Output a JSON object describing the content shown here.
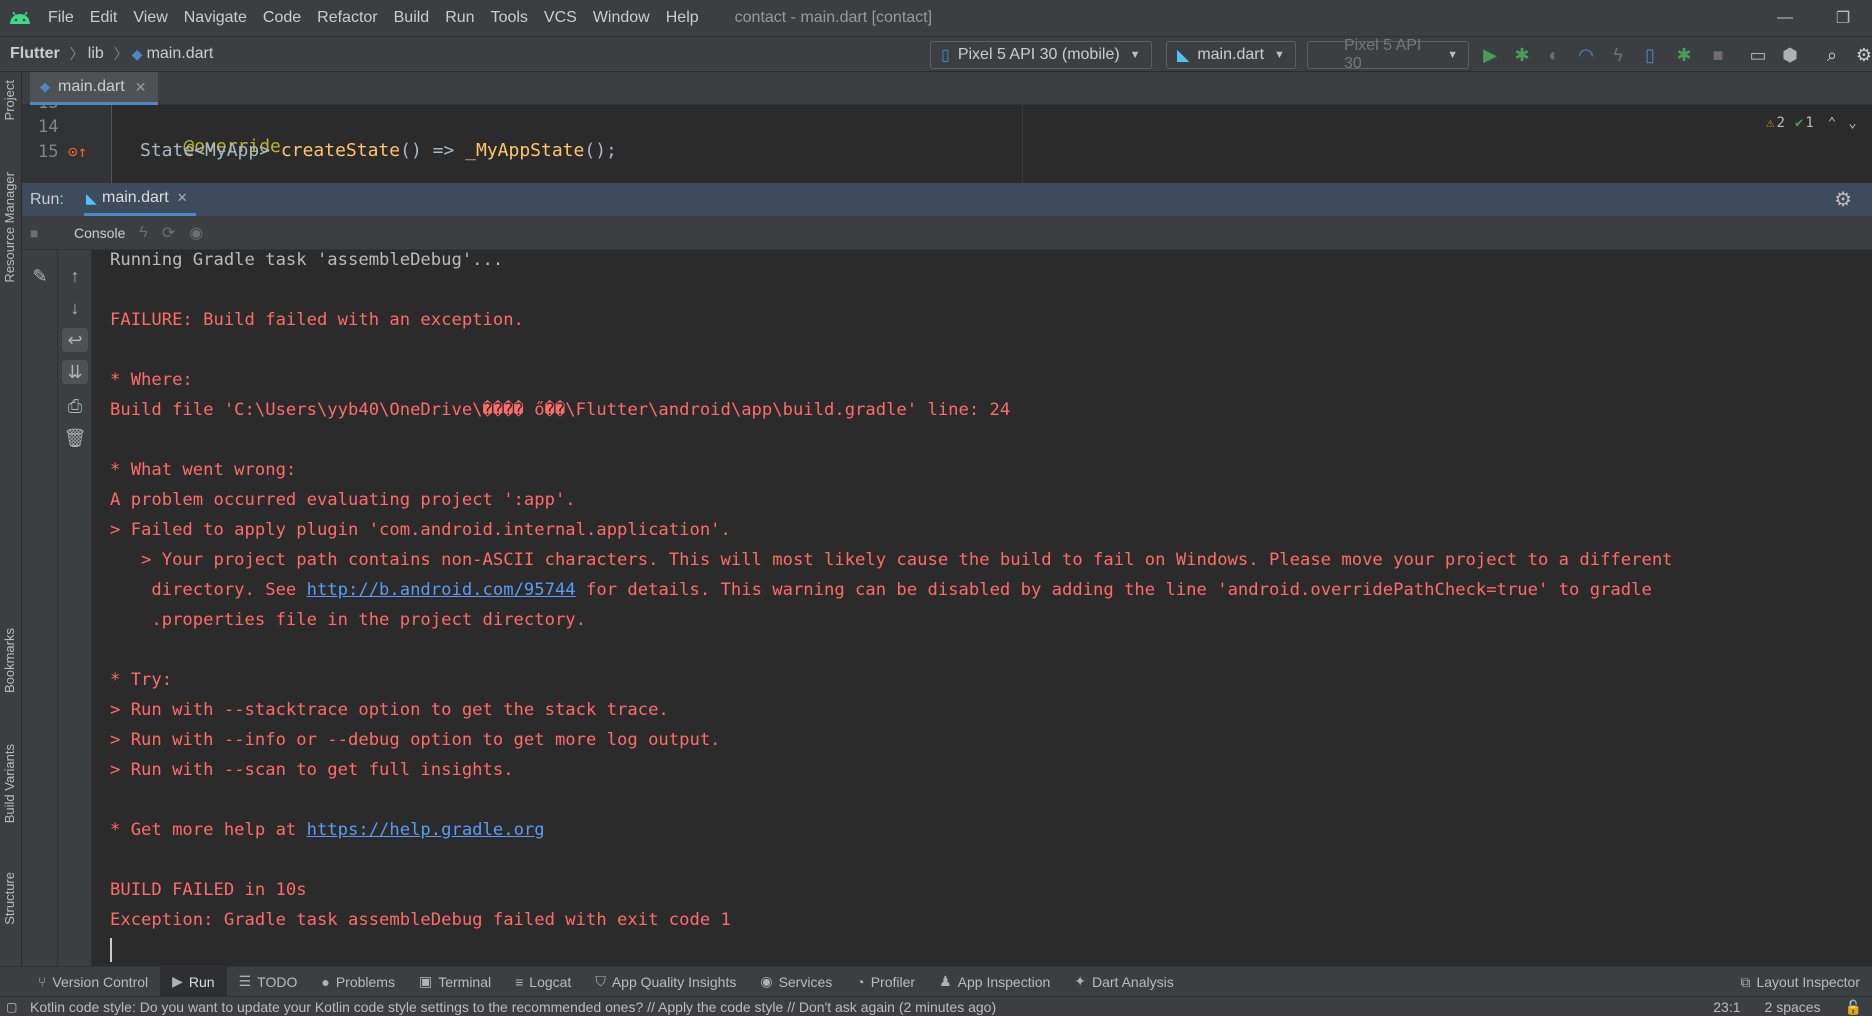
{
  "window": {
    "title": "contact - main.dart [contact]",
    "controls": {
      "minimize": "—",
      "restore": "❐"
    }
  },
  "menu": [
    "File",
    "Edit",
    "View",
    "Navigate",
    "Code",
    "Refactor",
    "Build",
    "Run",
    "Tools",
    "VCS",
    "Window",
    "Help"
  ],
  "breadcrumb": {
    "project": "Flutter",
    "folder": "lib",
    "file": "main.dart"
  },
  "toolbar": {
    "device": "Pixel 5 API 30 (mobile)",
    "run_config": "main.dart",
    "emulator": "Pixel 5 API 30"
  },
  "left_strip": {
    "project": "Project",
    "resource_manager": "Resource Manager",
    "bookmarks": "Bookmarks",
    "build_variants": "Build Variants",
    "structure": "Structure"
  },
  "editor": {
    "tab": "main.dart",
    "line_partial": "13",
    "lines": [
      {
        "number": "14",
        "annotation": "@override"
      },
      {
        "number": "15",
        "type": "State<MyApp> ",
        "method": "createState",
        "rest": "() => ",
        "call": "_MyAppState",
        "end": "();"
      }
    ],
    "inspections": {
      "warnings": "2",
      "checks": "1"
    }
  },
  "run_window": {
    "label": "Run:",
    "tab": "main.dart",
    "console_tab": "Console"
  },
  "console": {
    "lines": [
      {
        "kind": "normal",
        "text": "Running Gradle task 'assembleDebug'..."
      },
      {
        "kind": "blank",
        "text": ""
      },
      {
        "kind": "err",
        "text": "FAILURE: Build failed with an exception."
      },
      {
        "kind": "blank",
        "text": ""
      },
      {
        "kind": "err",
        "text": "* Where:"
      },
      {
        "kind": "err",
        "text": "Build file 'C:\\Users\\yyb40\\OneDrive\\���� ő��\\Flutter\\android\\app\\build.gradle' line: 24"
      },
      {
        "kind": "blank",
        "text": ""
      },
      {
        "kind": "err",
        "text": "* What went wrong:"
      },
      {
        "kind": "err",
        "text": "A problem occurred evaluating project ':app'."
      },
      {
        "kind": "err",
        "text": "> Failed to apply plugin 'com.android.internal.application'."
      },
      {
        "kind": "err",
        "text": "   > Your project path contains non-ASCII characters. This will most likely cause the build to fail on Windows. Please move your project to a different"
      },
      {
        "kind": "err_link",
        "pre": "    directory. See ",
        "link": "http://b.android.com/95744",
        "post": " for details. This warning can be disabled by adding the line 'android.overridePathCheck=true' to gradle"
      },
      {
        "kind": "err",
        "text": "    .properties file in the project directory."
      },
      {
        "kind": "blank",
        "text": ""
      },
      {
        "kind": "err",
        "text": "* Try:"
      },
      {
        "kind": "err",
        "text": "> Run with --stacktrace option to get the stack trace."
      },
      {
        "kind": "err",
        "text": "> Run with --info or --debug option to get more log output."
      },
      {
        "kind": "err",
        "text": "> Run with --scan to get full insights."
      },
      {
        "kind": "blank",
        "text": ""
      },
      {
        "kind": "err_link",
        "pre": "* Get more help at ",
        "link": "https://help.gradle.org",
        "post": ""
      },
      {
        "kind": "blank",
        "text": ""
      },
      {
        "kind": "err",
        "text": "BUILD FAILED in 10s"
      },
      {
        "kind": "err",
        "text": "Exception: Gradle task assembleDebug failed with exit code 1"
      }
    ]
  },
  "tool_windows": [
    {
      "id": "version-control",
      "label": "Version Control",
      "icon": "branch-icon",
      "glyph": "⑂"
    },
    {
      "id": "run",
      "label": "Run",
      "icon": "play-icon",
      "glyph": "▶",
      "active": true
    },
    {
      "id": "todo",
      "label": "TODO",
      "icon": "list-icon",
      "glyph": "☰"
    },
    {
      "id": "problems",
      "label": "Problems",
      "icon": "info-icon",
      "glyph": "●"
    },
    {
      "id": "terminal",
      "label": "Terminal",
      "icon": "terminal-icon",
      "glyph": "▣"
    },
    {
      "id": "logcat",
      "label": "Logcat",
      "icon": "log-icon",
      "glyph": "≡"
    },
    {
      "id": "app-quality-insights",
      "label": "App Quality Insights",
      "icon": "shield-icon",
      "glyph": "⛉"
    },
    {
      "id": "services",
      "label": "Services",
      "icon": "services-icon",
      "glyph": "◉"
    },
    {
      "id": "profiler",
      "label": "Profiler",
      "icon": "gauge-icon",
      "glyph": "◔"
    },
    {
      "id": "app-inspection",
      "label": "App Inspection",
      "icon": "android-icon",
      "glyph": "♟"
    },
    {
      "id": "dart-analysis",
      "label": "Dart Analysis",
      "icon": "dart-icon",
      "glyph": "✦"
    }
  ],
  "layout_inspector": "Layout Inspector",
  "status": {
    "message": "Kotlin code style: Do you want to update your Kotlin code style settings to the recommended ones? // Apply the code style // Don't ask again (2 minutes ago)",
    "position": "23:1",
    "indent": "2 spaces"
  },
  "colors": {
    "error": "#ff6b68",
    "link": "#589df6",
    "accent": "#4a88c7",
    "run_green": "#499c54"
  }
}
